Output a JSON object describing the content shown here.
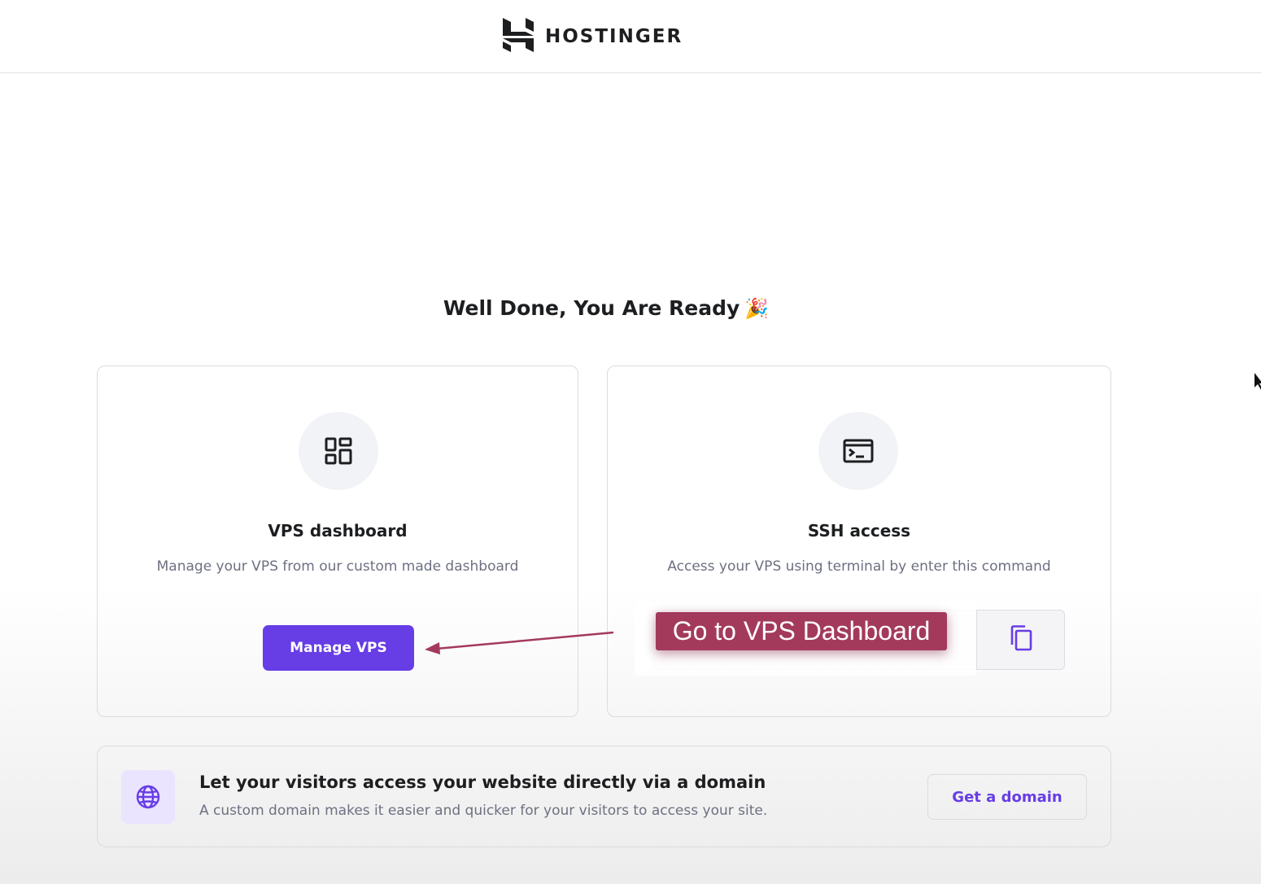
{
  "header": {
    "brand": "HOSTINGER",
    "logo_icon": "hostinger-h-logo"
  },
  "headline": {
    "text": "Well Done, You Are Ready",
    "emoji": "🎉"
  },
  "vps_card": {
    "icon": "dashboard-grid-icon",
    "title": "VPS dashboard",
    "description": "Manage your VPS from our custom made dashboard",
    "button_label": "Manage VPS"
  },
  "ssh_card": {
    "icon": "terminal-icon",
    "title": "SSH access",
    "description": "Access your VPS using terminal by enter this command",
    "copy_icon": "copy-icon"
  },
  "annotation": {
    "text": "Go to VPS Dashboard",
    "color": "#a33a5c"
  },
  "domain_banner": {
    "icon": "globe-icon",
    "title": "Let your visitors access your website directly via a domain",
    "description": "A custom domain makes it easier and quicker for your visitors to access your site.",
    "button_label": "Get a domain"
  },
  "colors": {
    "accent": "#673de6",
    "text_dark": "#1d1e20",
    "text_muted": "#6d7081"
  }
}
